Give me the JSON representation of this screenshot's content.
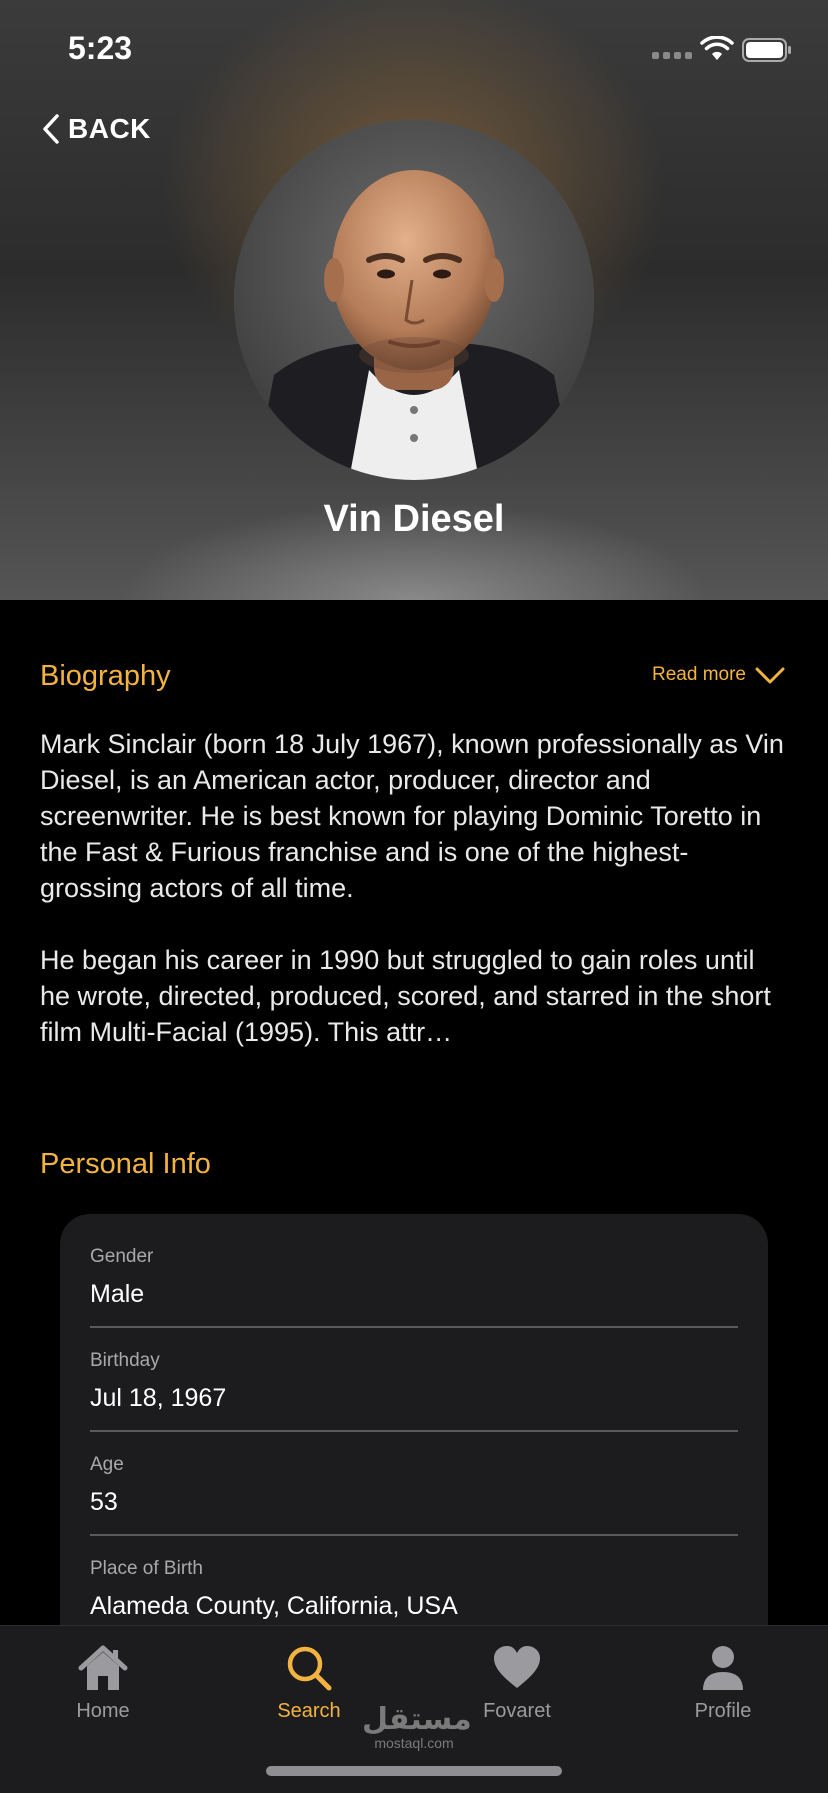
{
  "status_bar": {
    "time": "5:23"
  },
  "nav": {
    "back_label": "BACK"
  },
  "profile": {
    "name": "Vin Diesel"
  },
  "biography": {
    "title": "Biography",
    "read_more": "Read more",
    "paragraphs": [
      "Mark Sinclair (born 18 July 1967), known professionally as Vin Diesel, is an American actor, producer, director and screenwriter. He is best known for playing Dominic Toretto in the Fast & Furious franchise and is one of the highest-grossing actors of all time.",
      "He began his career in 1990 but struggled to gain roles until he wrote, directed, produced, scored, and starred in the short film Multi-Facial (1995). This attr…"
    ]
  },
  "personal_info": {
    "title": "Personal Info",
    "fields": [
      {
        "label": "Gender",
        "value": "Male"
      },
      {
        "label": "Birthday",
        "value": "Jul 18, 1967"
      },
      {
        "label": "Age",
        "value": "53"
      },
      {
        "label": "Place of Birth",
        "value": "Alameda County, California, USA"
      }
    ]
  },
  "tab_bar": {
    "items": [
      {
        "label": "Home",
        "icon": "house-icon"
      },
      {
        "label": "Search",
        "icon": "magnifier-icon",
        "active": true
      },
      {
        "label": "Fovaret",
        "icon": "heart-icon"
      },
      {
        "label": "Profile",
        "icon": "person-icon"
      }
    ]
  },
  "watermark": {
    "arabic": "مستقل",
    "latin": "mostaql.com"
  },
  "colors": {
    "accent": "#f3b341",
    "background": "#000000",
    "card": "#1c1c1e"
  }
}
